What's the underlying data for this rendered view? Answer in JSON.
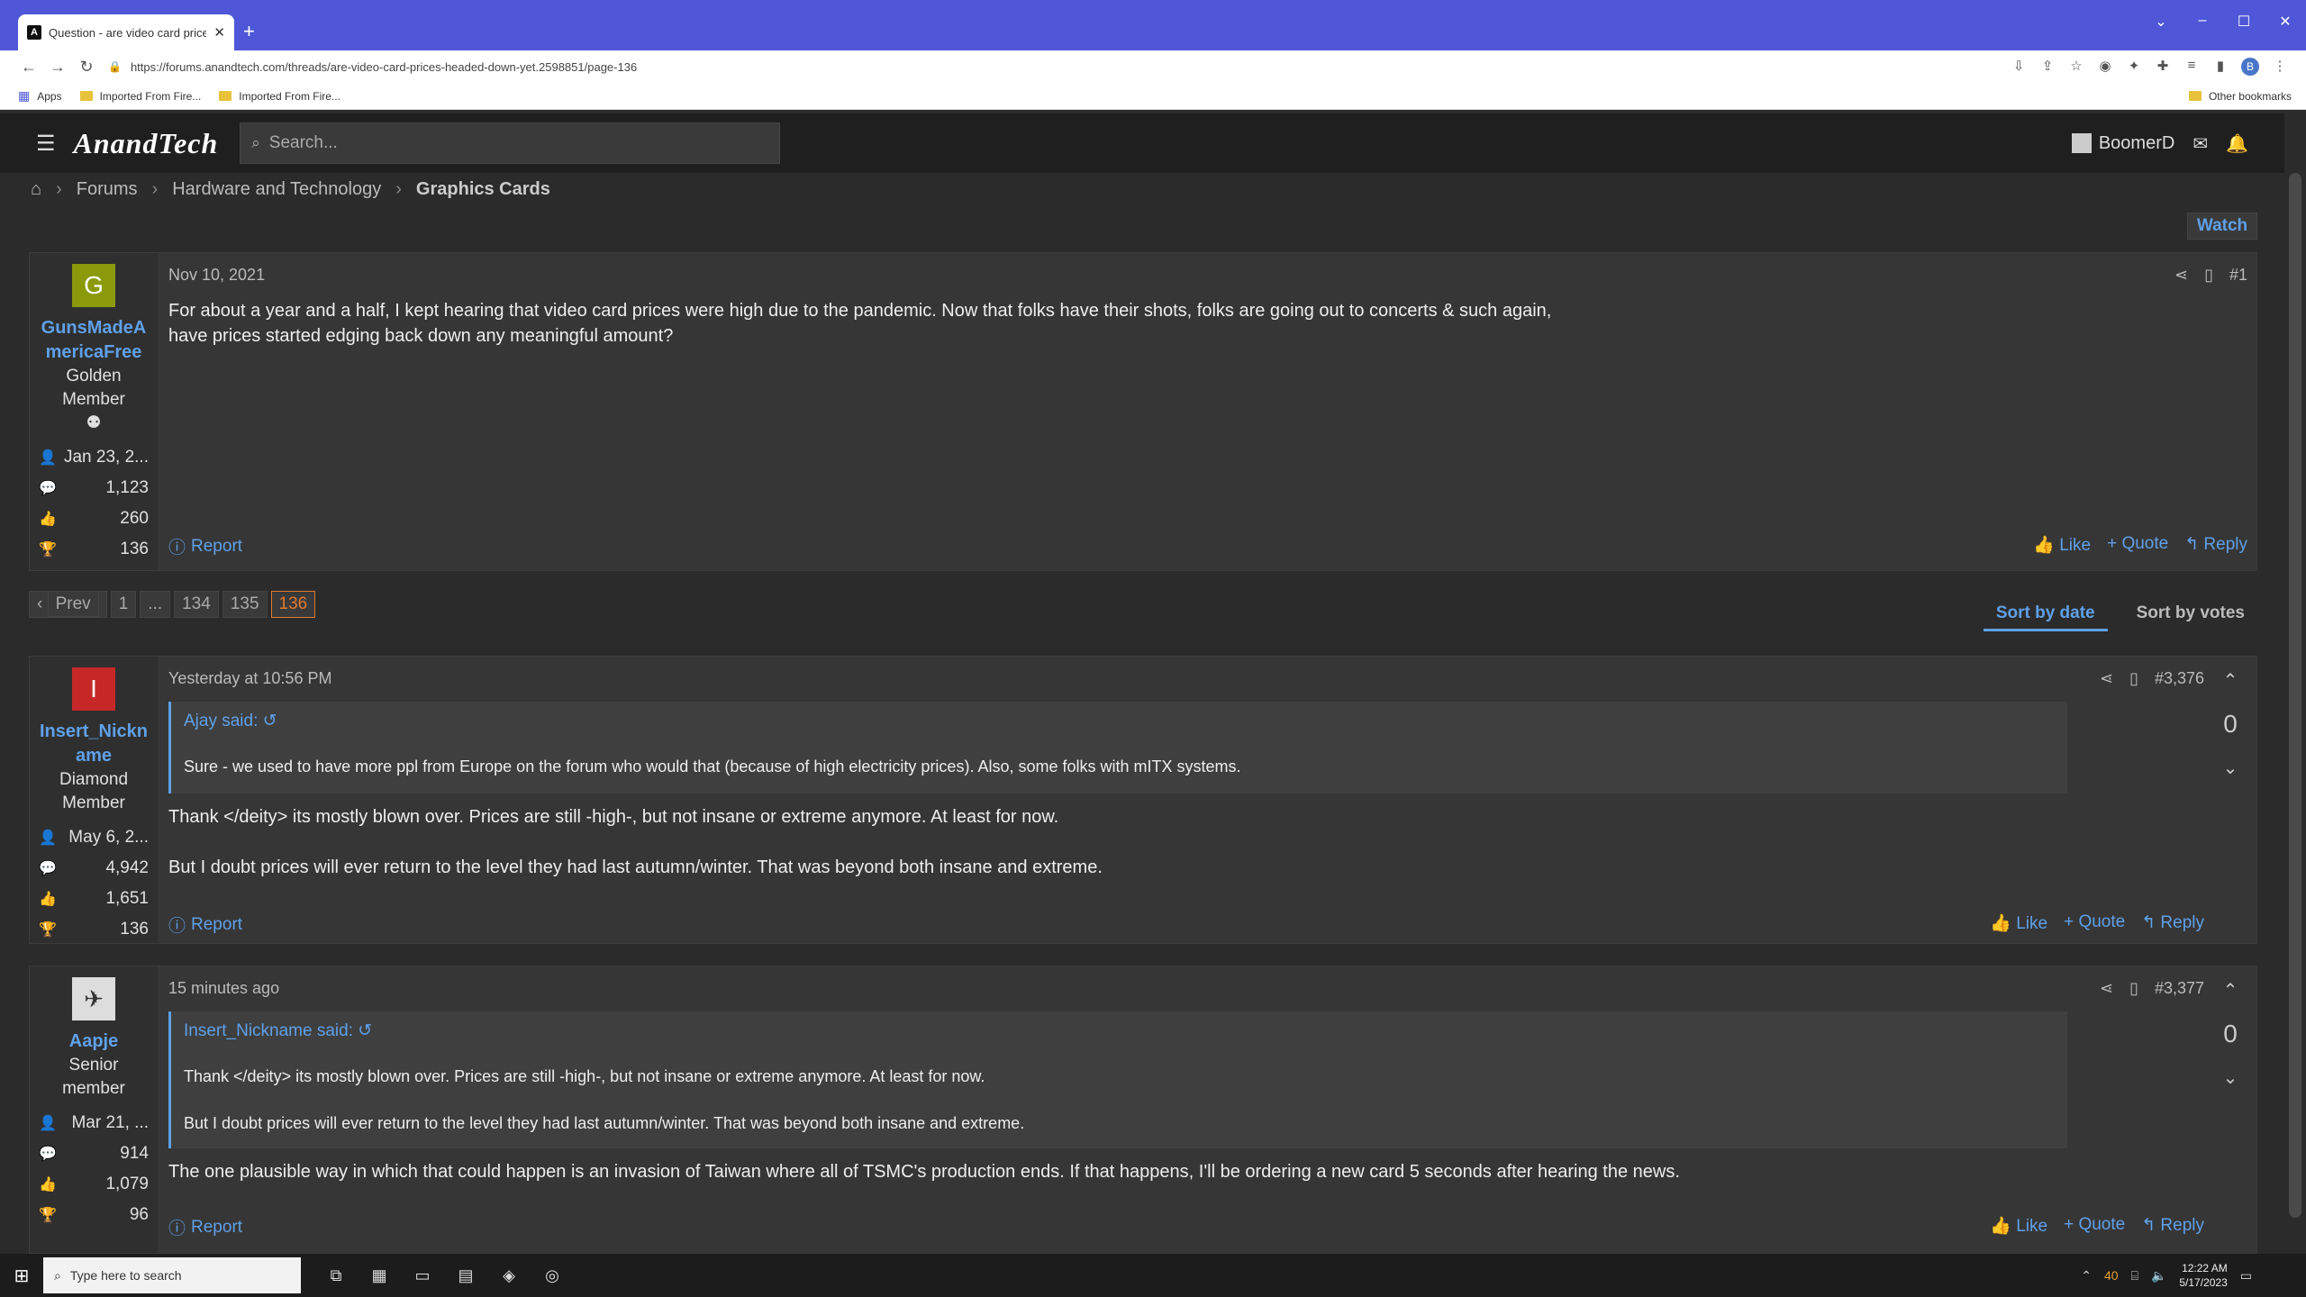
{
  "browser": {
    "tab_title": "Question - are video card prices",
    "tab_favicon": "A",
    "url": "https://forums.anandtech.com/threads/are-video-card-prices-headed-down-yet.2598851/page-136",
    "bookmarks": [
      {
        "label": "Apps",
        "icon": "apps-grid-icon"
      },
      {
        "label": "Imported From Fire...",
        "icon": "folder-icon"
      },
      {
        "label": "Imported From Fire...",
        "icon": "folder-icon"
      }
    ],
    "other_bookmarks": "Other bookmarks",
    "profile_initial": "B"
  },
  "site": {
    "logo": "AnandTech",
    "search_placeholder": "Search...",
    "username": "BoomerD"
  },
  "breadcrumb": {
    "items": [
      "Forums",
      "Hardware and Technology",
      "Graphics Cards"
    ]
  },
  "watch_label": "Watch",
  "pagination": {
    "prev": "Prev",
    "pages": [
      "1",
      "...",
      "134",
      "135",
      "136"
    ],
    "current": "136"
  },
  "sort": {
    "by_date": "Sort by date",
    "by_votes": "Sort by votes"
  },
  "actions": {
    "report": "Report",
    "like": "Like",
    "quote": "Quote",
    "reply": "Reply"
  },
  "posts": [
    {
      "author": "GunsMadeAmericaFree",
      "avatar_letter": "G",
      "avatar_color": "#8a9a0a",
      "title_line1": "Golden",
      "title_line2": "Member",
      "joined": "Jan 23, 2...",
      "messages": "1,123",
      "reactions": "260",
      "points": "136",
      "date": "Nov 10, 2021",
      "number": "#1",
      "text1": "For about a year and a half, I kept hearing that video card prices were high due to the pandemic. Now that folks have their shots, folks are going out to concerts & such again,",
      "text2": "have prices started edging back down any meaningful amount?"
    },
    {
      "author": "Insert_Nickname",
      "avatar_letter": "I",
      "avatar_color": "#c62828",
      "title_line1": "Diamond",
      "title_line2": "Member",
      "joined": "May 6, 2...",
      "messages": "4,942",
      "reactions": "1,651",
      "points": "136",
      "date": "Yesterday at 10:56 PM",
      "number": "#3,376",
      "votes": "0",
      "quote_author": "Ajay said:",
      "quote_text": "Sure - we used to have more ppl from Europe on the forum who would that (because of high electricity prices). Also, some folks with mITX systems.",
      "text1": "Thank </deity> its mostly blown over. Prices are still -high-, but not insane or extreme anymore. At least for now.",
      "text2": "But I doubt prices will ever return to the level they had last autumn/winter. That was beyond both insane and extreme."
    },
    {
      "author": "Aapje",
      "avatar_color": "#dddddd",
      "title_line1": "Senior",
      "title_line2": "member",
      "joined": "Mar 21, ...",
      "messages": "914",
      "reactions": "1,079",
      "points": "96",
      "date": "15 minutes ago",
      "number": "#3,377",
      "votes": "0",
      "quote_author": "Insert_Nickname said:",
      "quote_text1": "Thank </deity> its mostly blown over. Prices are still -high-, but not insane or extreme anymore. At least for now.",
      "quote_text2": "But I doubt prices will ever return to the level they had last autumn/winter. That was beyond both insane and extreme.",
      "text1": "The one plausible way in which that could happen is an invasion of Taiwan where all of TSMC's production ends. If that happens, I'll be ordering a new card 5 seconds after hearing the news."
    }
  ],
  "taskbar": {
    "search_placeholder": "Type here to search",
    "temperature": "40",
    "time": "12:22 AM",
    "date": "5/17/2023"
  }
}
